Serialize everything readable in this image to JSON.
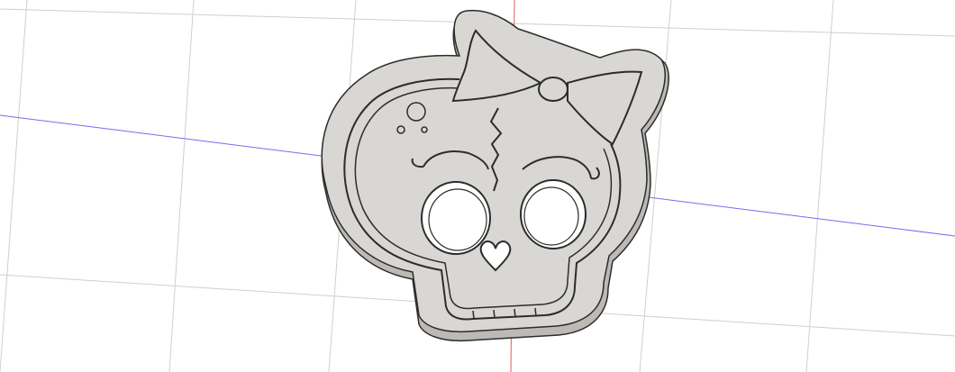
{
  "viewport": {
    "background": "#ffffff",
    "grid_color": "#cfcfcf",
    "axes": {
      "x_axis_color": "#6f6ff0",
      "z_axis_color": "#e05a5a"
    }
  },
  "model": {
    "name": "skull-with-bow-cookie-cutter",
    "body_color": "#d9d7d4",
    "edge_color": "#2c2c2c",
    "wall_color": "#bdbab6"
  }
}
